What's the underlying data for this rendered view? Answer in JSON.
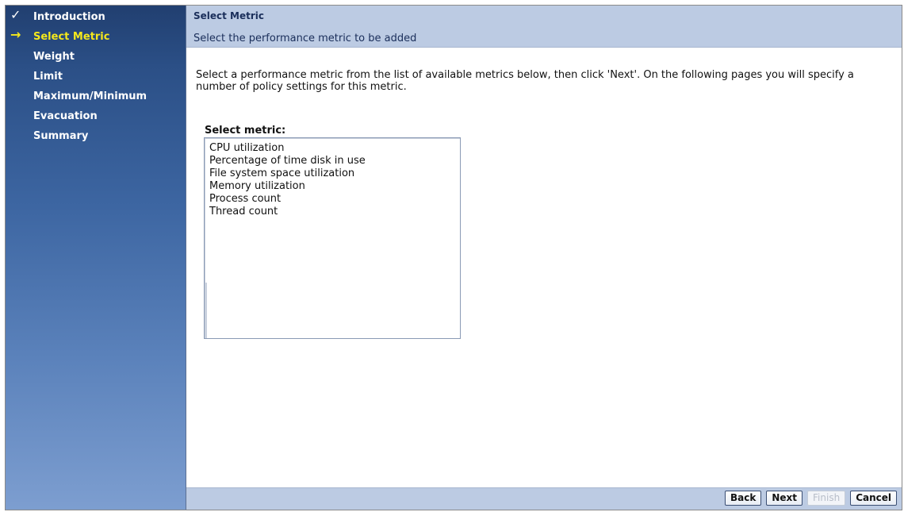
{
  "wizard": {
    "steps": [
      {
        "label": "Introduction",
        "state": "completed",
        "marker": "✓",
        "marker_icon": "checkmark-icon"
      },
      {
        "label": "Select Metric",
        "state": "current",
        "marker": "→",
        "marker_icon": "arrow-right-icon"
      },
      {
        "label": "Weight",
        "state": "pending",
        "marker": ""
      },
      {
        "label": "Limit",
        "state": "pending",
        "marker": ""
      },
      {
        "label": "Maximum/Minimum",
        "state": "pending",
        "marker": ""
      },
      {
        "label": "Evacuation",
        "state": "pending",
        "marker": ""
      },
      {
        "label": "Summary",
        "state": "pending",
        "marker": ""
      }
    ]
  },
  "page": {
    "title": "Select Metric",
    "subtitle": "Select the performance metric to be added",
    "instructions": "Select a performance metric from the list of available metrics below, then click 'Next'. On the following pages you will specify a number of policy settings for this metric."
  },
  "metric_select": {
    "label": "Select metric:",
    "options": [
      "CPU utilization",
      "Percentage of time disk in use",
      "File system space utilization",
      "Memory utilization",
      "Process count",
      "Thread count"
    ]
  },
  "footer": {
    "back_label": "Back",
    "next_label": "Next",
    "finish_label": "Finish",
    "finish_enabled": false,
    "cancel_label": "Cancel"
  },
  "colors": {
    "sidebar_top": "#213f70",
    "sidebar_bottom": "#7d9ed0",
    "current_step": "#f4e81c",
    "banner": "#bccbe3"
  }
}
